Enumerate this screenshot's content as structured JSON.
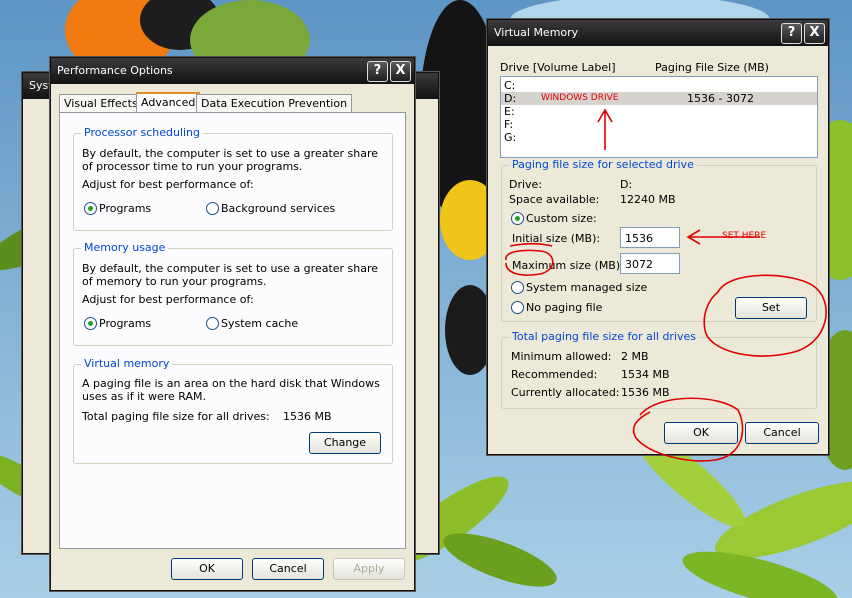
{
  "background_window": {
    "title": "Syst"
  },
  "perf": {
    "title": "Performance Options",
    "help": "?",
    "close": "X",
    "tabs": [
      "Visual Effects",
      "Advanced",
      "Data Execution Prevention"
    ],
    "processor": {
      "legend": "Processor scheduling",
      "desc": "By default, the computer is set to use a greater share of processor time to run your programs.",
      "adjust": "Adjust for best performance of:",
      "opt1": "Programs",
      "opt2": "Background services"
    },
    "memory": {
      "legend": "Memory usage",
      "desc": "By default, the computer is set to use a greater share of memory to run your programs.",
      "adjust": "Adjust for best performance of:",
      "opt1": "Programs",
      "opt2": "System cache"
    },
    "vm": {
      "legend": "Virtual memory",
      "desc": "A paging file is an area on the hard disk that Windows uses as if it were RAM.",
      "total_label": "Total paging file size for all drives:",
      "total_value": "1536 MB",
      "change": "Change"
    },
    "ok": "OK",
    "cancel": "Cancel",
    "apply": "Apply"
  },
  "vmdlg": {
    "title": "Virtual Memory",
    "help": "?",
    "close": "X",
    "col_drive": "Drive  [Volume Label]",
    "col_size": "Paging File Size (MB)",
    "drives": [
      {
        "letter": "C:",
        "label": "",
        "size": ""
      },
      {
        "letter": "D:",
        "label": "WINDOWS DRIVE",
        "size": "1536 - 3072"
      },
      {
        "letter": "E:",
        "label": "",
        "size": ""
      },
      {
        "letter": "F:",
        "label": "",
        "size": ""
      },
      {
        "letter": "G:",
        "label": "",
        "size": ""
      }
    ],
    "selected": {
      "legend": "Paging file size for selected drive",
      "drive_label": "Drive:",
      "drive_value": "D:",
      "space_label": "Space available:",
      "space_value": "12240 MB",
      "custom": "Custom size:",
      "initial_label": "Initial size (MB):",
      "initial_value": "1536",
      "max_label": "Maximum size (MB):",
      "max_value": "3072",
      "system_managed": "System managed size",
      "no_paging": "No paging file",
      "set": "Set"
    },
    "total": {
      "legend": "Total paging file size for all drives",
      "min_label": "Minimum allowed:",
      "min_value": "2 MB",
      "rec_label": "Recommended:",
      "rec_value": "1534 MB",
      "cur_label": "Currently allocated:",
      "cur_value": "1536 MB"
    },
    "ok": "OK",
    "cancel": "Cancel"
  },
  "annotation": {
    "set_here": "SET HERE"
  },
  "colors": {
    "annotation_red": "#e00000",
    "group_title": "#0046d5",
    "selected_row": "#d6d3ce"
  }
}
